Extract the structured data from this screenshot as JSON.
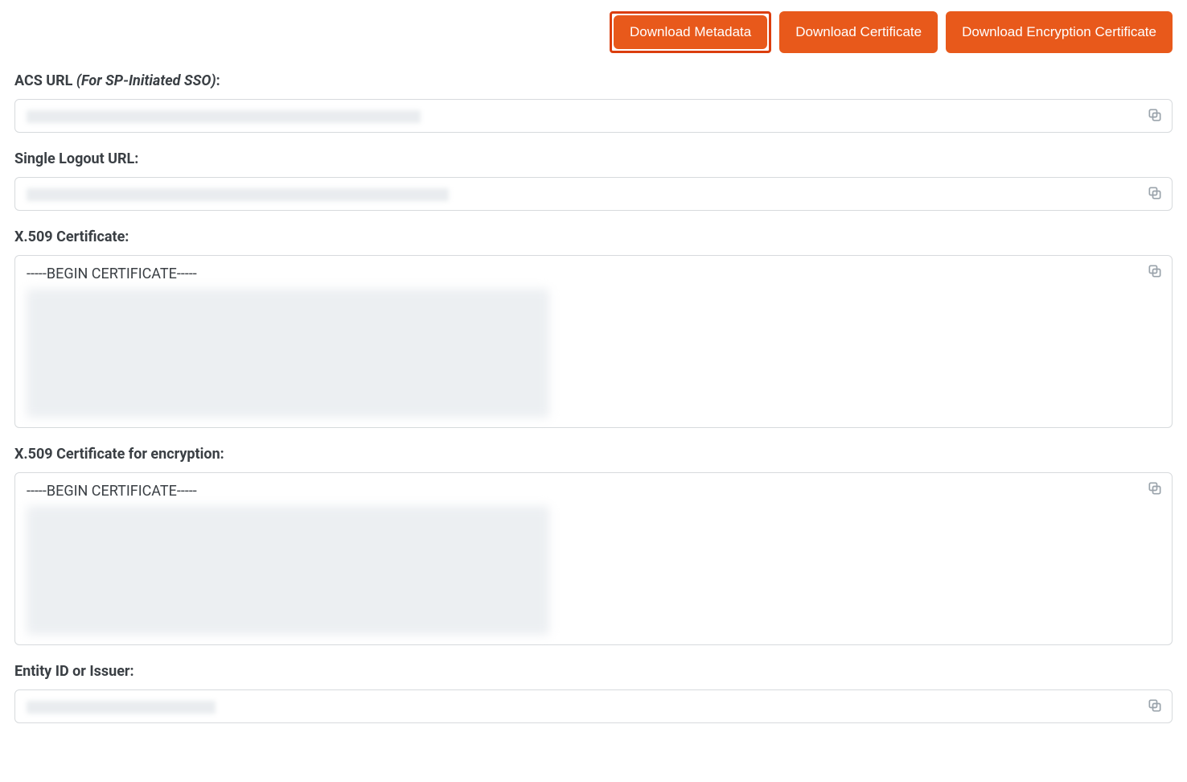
{
  "buttons": {
    "download_metadata": "Download Metadata",
    "download_certificate": "Download Certificate",
    "download_encryption_certificate": "Download Encryption Certificate"
  },
  "fields": {
    "acs_url": {
      "label_prefix": "ACS URL ",
      "label_italic": "(For SP-Initiated SSO)",
      "label_suffix": ":",
      "value_redacted": true
    },
    "single_logout_url": {
      "label": "Single Logout URL:",
      "value_redacted": true
    },
    "x509_certificate": {
      "label": "X.509 Certificate:",
      "begin_line": "-----BEGIN CERTIFICATE-----",
      "body_redacted": true
    },
    "x509_certificate_encryption": {
      "label": "X.509 Certificate for encryption:",
      "begin_line": "-----BEGIN CERTIFICATE-----",
      "body_redacted": true
    },
    "entity_id": {
      "label": "Entity ID or Issuer:",
      "value_redacted": true
    }
  },
  "colors": {
    "accent": "#e8591b",
    "highlight_border": "#db3e0e",
    "text": "#3a3f44",
    "border": "#d7dadd",
    "icon": "#9aa3ab"
  }
}
